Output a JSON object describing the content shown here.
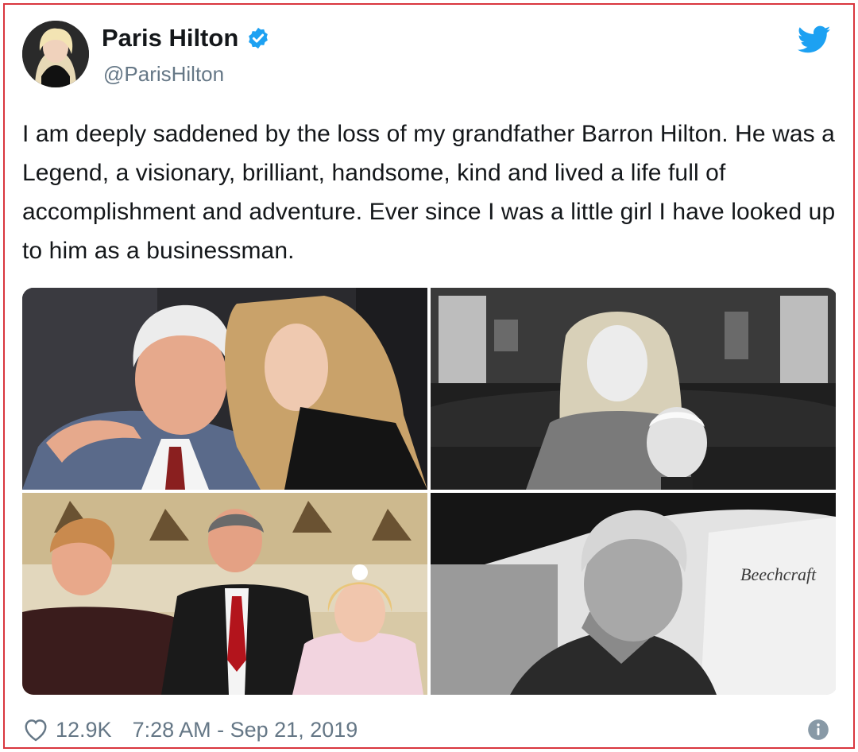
{
  "user": {
    "display_name": "Paris Hilton",
    "handle": "@ParisHilton",
    "verified": true
  },
  "tweet": {
    "text": "I am deeply saddened by the loss of my grandfather Barron Hilton. He was a Legend, a visionary, brilliant, handsome, kind and lived a life full of accomplishment and adventure. Ever since I was a little girl I have looked up to him as a businessman."
  },
  "media": {
    "photo_count": 4,
    "photo_4_sign_text": "Beechcraft"
  },
  "footer": {
    "likes": "12.9K",
    "timestamp": "7:28 AM - Sep 21, 2019"
  },
  "icons": {
    "brand": "twitter-bird-icon",
    "verified": "verified-badge-icon",
    "like": "heart-icon",
    "info": "info-icon"
  },
  "colors": {
    "accent": "#1da1f2",
    "muted": "#657786",
    "text": "#14171a",
    "frame": "#d9363e"
  }
}
